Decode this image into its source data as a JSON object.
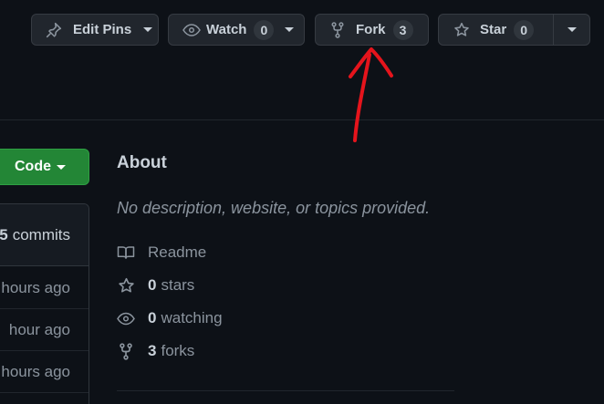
{
  "header_actions": {
    "edit_pins": {
      "label": "Edit Pins",
      "icon": "pin-icon"
    },
    "watch": {
      "label": "Watch",
      "count": "0",
      "icon": "eye-icon"
    },
    "fork": {
      "label": "Fork",
      "count": "3",
      "icon": "repo-forked-icon"
    },
    "star": {
      "label": "Star",
      "count": "0",
      "icon": "star-icon"
    }
  },
  "code_button": {
    "label": "Code"
  },
  "file_list": {
    "commits_count": "5",
    "commits_label": "commits",
    "times": [
      "hours ago",
      "hour ago",
      "hours ago"
    ]
  },
  "about": {
    "title": "About",
    "description": "No description, website, or topics provided.",
    "readme": "Readme",
    "stars_count": "0",
    "stars_label": "stars",
    "watching_count": "0",
    "watching_label": "watching",
    "forks_count": "3",
    "forks_label": "forks"
  },
  "colors": {
    "background": "#0d1117",
    "button_bg": "#21262d",
    "code_green": "#238636",
    "annotation_arrow": "#e5141c"
  }
}
